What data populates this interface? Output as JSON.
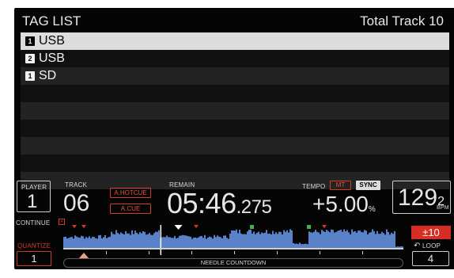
{
  "tag_list": {
    "title": "TAG LIST",
    "total_label": "Total Track 10",
    "rows": [
      {
        "badge": "1",
        "label": "USB",
        "selected": true
      },
      {
        "badge": "2",
        "label": "USB",
        "selected": false
      },
      {
        "badge": "1",
        "label": "SD",
        "selected": false
      },
      {
        "badge": "",
        "label": "",
        "selected": false
      },
      {
        "badge": "",
        "label": "",
        "selected": false
      },
      {
        "badge": "",
        "label": "",
        "selected": false
      },
      {
        "badge": "",
        "label": "",
        "selected": false
      },
      {
        "badge": "",
        "label": "",
        "selected": false
      },
      {
        "badge": "",
        "label": "",
        "selected": false
      }
    ]
  },
  "player": {
    "label": "PLAYER",
    "number": "1"
  },
  "track": {
    "label": "TRACK",
    "number": "06"
  },
  "hotcue": {
    "auto_hotcue": "A.HOTCUE",
    "auto_cue": "A.CUE"
  },
  "remain": {
    "label": "REMAIN",
    "time_main": "05:46",
    "time_ms": ".275"
  },
  "tempo": {
    "label": "TEMPO",
    "mt": "MT",
    "sync": "SYNC",
    "value": "+5.00",
    "unit": "%"
  },
  "bpm": {
    "integer": "129",
    "decimal": "2",
    "unit": "BPM"
  },
  "continue_label": "CONTINUE",
  "quantize": {
    "label": "QUANTIZE",
    "value": "1"
  },
  "tempo_range": "±10",
  "loop": {
    "label": "LOOP",
    "value": "4"
  },
  "needle_countdown": "NEEDLE COUNTDOWN",
  "colors": {
    "waveform": "#5a82c8",
    "waveform_light": "#8fb0e8",
    "red_accent": "#d23a2a",
    "green_marker": "#3fb34a"
  },
  "playhead_position_fraction": 0.285
}
